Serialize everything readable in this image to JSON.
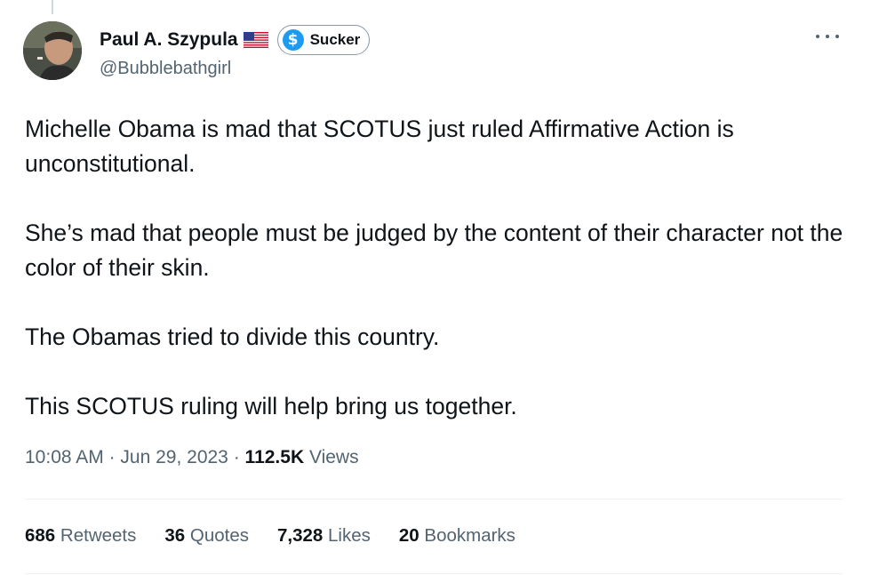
{
  "author": {
    "display_name": "Paul A. Szypula",
    "flag": "us-flag-icon",
    "label": "Sucker",
    "label_icon": "dollar-icon",
    "handle": "@Bubblebathgirl"
  },
  "tweet": {
    "paragraphs": [
      "Michelle Obama is mad that SCOTUS just ruled Affirmative Action is unconstitutional.",
      "She’s mad that people must be judged by the content of their character not the color of their skin.",
      "The Obamas tried to divide this country.",
      "This SCOTUS ruling will help bring us together."
    ],
    "time": "10:08 AM",
    "date": "Jun 29, 2023",
    "separator": "·",
    "views_count": "112.5K",
    "views_label": "Views"
  },
  "stats": [
    {
      "count": "686",
      "label": "Retweets"
    },
    {
      "count": "36",
      "label": "Quotes"
    },
    {
      "count": "7,328",
      "label": "Likes"
    },
    {
      "count": "20",
      "label": "Bookmarks"
    }
  ],
  "colors": {
    "text": "#0f1419",
    "secondary": "#536471",
    "accent": "#1d9bf0",
    "divider": "#eff3f4"
  }
}
